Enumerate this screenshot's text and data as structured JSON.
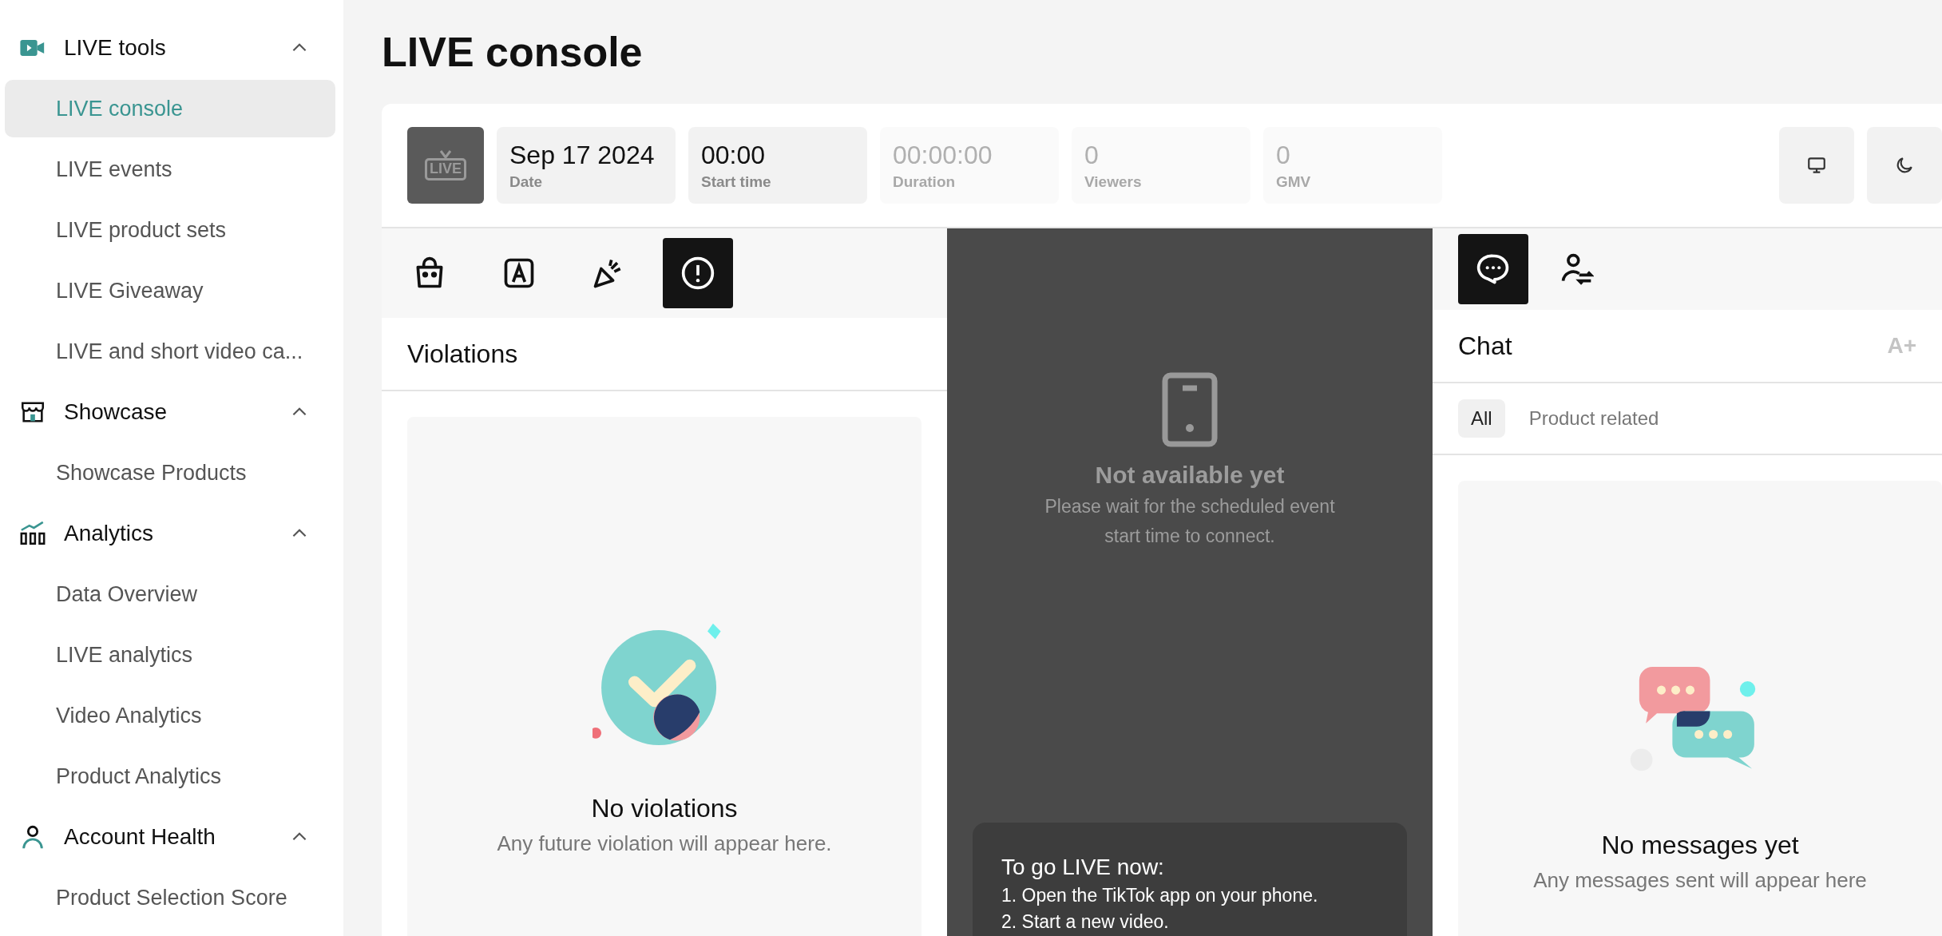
{
  "sidebar": {
    "groups": [
      {
        "label": "LIVE tools",
        "expanded": true,
        "items": [
          {
            "label": "LIVE console",
            "selected": true
          },
          {
            "label": "LIVE events",
            "selected": false
          },
          {
            "label": "LIVE product sets",
            "selected": false
          },
          {
            "label": "LIVE Giveaway",
            "selected": false
          },
          {
            "label": "LIVE and short video ca...",
            "selected": false
          }
        ]
      },
      {
        "label": "Showcase",
        "expanded": true,
        "items": [
          {
            "label": "Showcase Products",
            "selected": false
          }
        ]
      },
      {
        "label": "Analytics",
        "expanded": true,
        "items": [
          {
            "label": "Data Overview",
            "selected": false
          },
          {
            "label": "LIVE analytics",
            "selected": false
          },
          {
            "label": "Video Analytics",
            "selected": false
          },
          {
            "label": "Product Analytics",
            "selected": false
          }
        ]
      },
      {
        "label": "Account Health",
        "expanded": true,
        "items": [
          {
            "label": "Product Selection Score",
            "selected": false
          }
        ]
      }
    ]
  },
  "page_title": "LIVE console",
  "thumbnail": {
    "label": "LIVE"
  },
  "stats": [
    {
      "value": "Sep 17 2024",
      "label": "Date",
      "disabled": false
    },
    {
      "value": "00:00",
      "label": "Start time",
      "disabled": false
    },
    {
      "value": "00:00:00",
      "label": "Duration",
      "disabled": true
    },
    {
      "value": "0",
      "label": "Viewers",
      "disabled": true
    },
    {
      "value": "0",
      "label": "GMV",
      "disabled": true
    }
  ],
  "toolbar_buttons": [
    {
      "kind": "monitor"
    },
    {
      "kind": "moon"
    }
  ],
  "left_panel": {
    "tabs": [
      {
        "kind": "bag",
        "selected": false
      },
      {
        "kind": "letter",
        "selected": false
      },
      {
        "kind": "party",
        "selected": false
      },
      {
        "kind": "alert",
        "selected": true
      }
    ],
    "title": "Violations",
    "empty_title": "No violations",
    "empty_text": "Any future violation will appear here."
  },
  "preview": {
    "title": "Not available yet",
    "text": "Please wait for the scheduled event start time to connect.",
    "instructions_title": "To go LIVE now:",
    "steps": [
      "1. Open the TikTok app on your phone.",
      "2. Start a new video."
    ]
  },
  "chat": {
    "tabs": [
      {
        "kind": "chat",
        "selected": true
      },
      {
        "kind": "user-swap",
        "selected": false
      }
    ],
    "title": "Chat",
    "font_button": "A+",
    "filters": [
      {
        "label": "All",
        "selected": true
      },
      {
        "label": "Product related",
        "selected": false
      }
    ],
    "empty_title": "No messages yet",
    "empty_text": "Any messages sent will appear here"
  }
}
